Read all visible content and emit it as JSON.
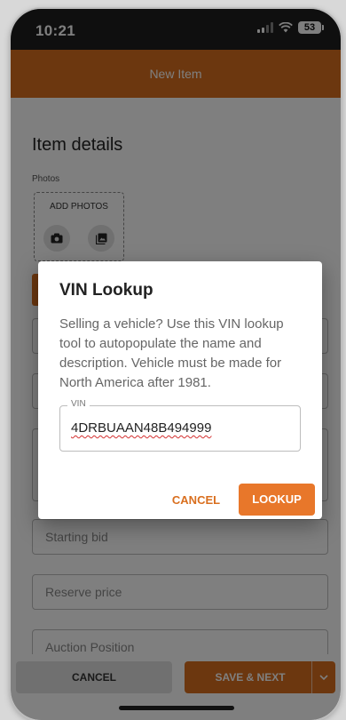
{
  "status_bar": {
    "time": "10:21",
    "battery": "53"
  },
  "app_bar": {
    "title": "New Item"
  },
  "form": {
    "section_title": "Item details",
    "photos_label": "Photos",
    "add_photos_label": "ADD PHOTOS",
    "fields": {
      "starting_bid_placeholder": "Starting bid",
      "reserve_price_placeholder": "Reserve price",
      "auction_position_placeholder": "Auction Position"
    }
  },
  "bottom_bar": {
    "cancel_label": "CANCEL",
    "save_next_label": "SAVE & NEXT"
  },
  "dialog": {
    "title": "VIN Lookup",
    "body": "Selling a vehicle? Use this VIN lookup tool to autopopulate the name and description. Vehicle must be made for North America after 1981.",
    "vin_label": "VIN",
    "vin_value": "4DRBUAAN48B494999",
    "cancel_label": "CANCEL",
    "lookup_label": "LOOKUP"
  },
  "colors": {
    "accent": "#d96f1f",
    "status_bar": "#1f1f1f",
    "scrim": "rgba(0,0,0,0.5)"
  },
  "icons": [
    "camera-icon",
    "gallery-icon",
    "signal-icon",
    "wifi-icon",
    "battery-icon",
    "chevron-down-icon"
  ]
}
